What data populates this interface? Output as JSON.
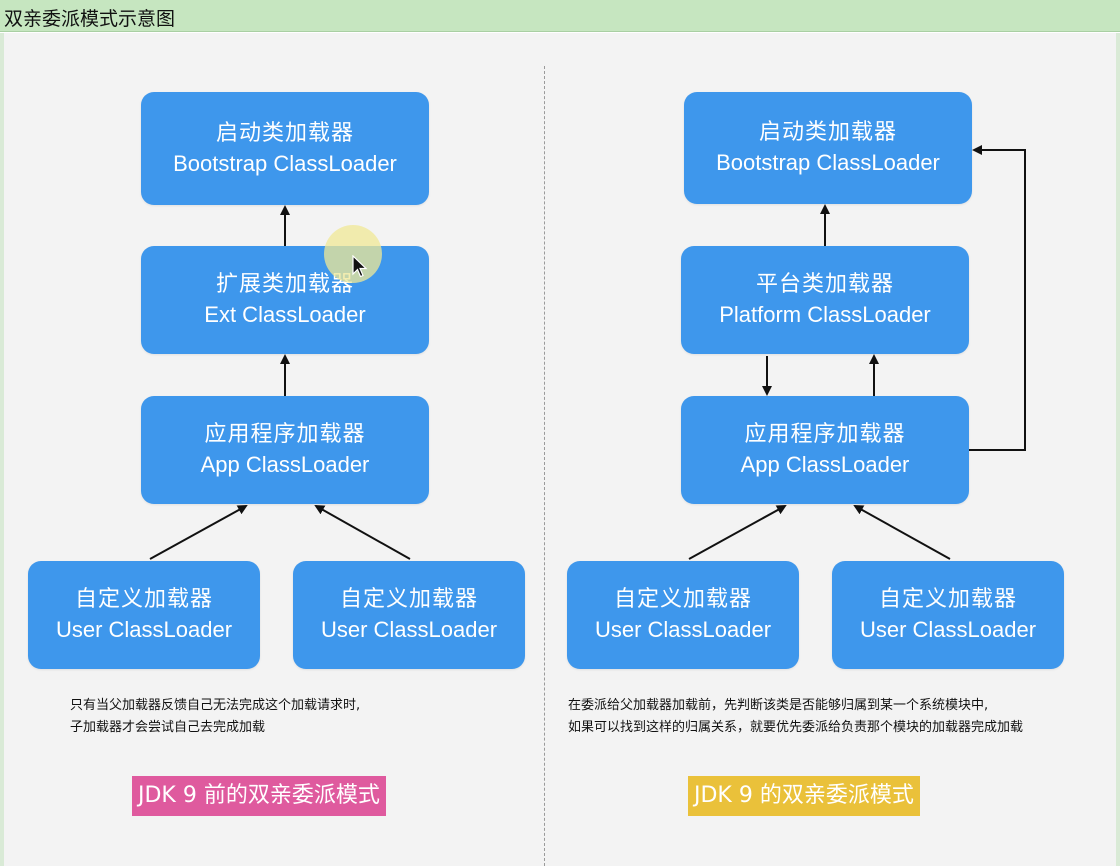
{
  "window": {
    "title": "双亲委派模式示意图"
  },
  "left": {
    "boxes": {
      "bootstrap": {
        "cn": "启动类加载器",
        "en": "Bootstrap ClassLoader"
      },
      "ext": {
        "cn": "扩展类加载器",
        "en": "Ext ClassLoader"
      },
      "app": {
        "cn": "应用程序加载器",
        "en": "App ClassLoader"
      },
      "user1": {
        "cn": "自定义加载器",
        "en": "User ClassLoader"
      },
      "user2": {
        "cn": "自定义加载器",
        "en": "User ClassLoader"
      }
    },
    "note": {
      "line1": "只有当父加载器反馈自己无法完成这个加载请求时,",
      "line2": "子加载器才会尝试自己去完成加载"
    },
    "label": "JDK 9 前的双亲委派模式"
  },
  "right": {
    "boxes": {
      "bootstrap": {
        "cn": "启动类加载器",
        "en": "Bootstrap ClassLoader"
      },
      "platform": {
        "cn": "平台类加载器",
        "en": "Platform ClassLoader"
      },
      "app": {
        "cn": "应用程序加载器",
        "en": "App ClassLoader"
      },
      "user1": {
        "cn": "自定义加载器",
        "en": "User ClassLoader"
      },
      "user2": {
        "cn": "自定义加载器",
        "en": "User ClassLoader"
      }
    },
    "note": {
      "line1": "在委派给父加载器加载前，先判断该类是否能够归属到某一个系统模块中,",
      "line2": "如果可以找到这样的归属关系，就要优先委派给负责那个模块的加载器完成加载"
    },
    "label": "JDK 9 的双亲委派模式"
  },
  "colors": {
    "box": "#3e97ec",
    "title_bar": "#c6e6c0",
    "label_left": "#df5a9e",
    "label_right": "#eac13a"
  },
  "icons": {
    "cursor": "mouse-pointer-icon"
  }
}
